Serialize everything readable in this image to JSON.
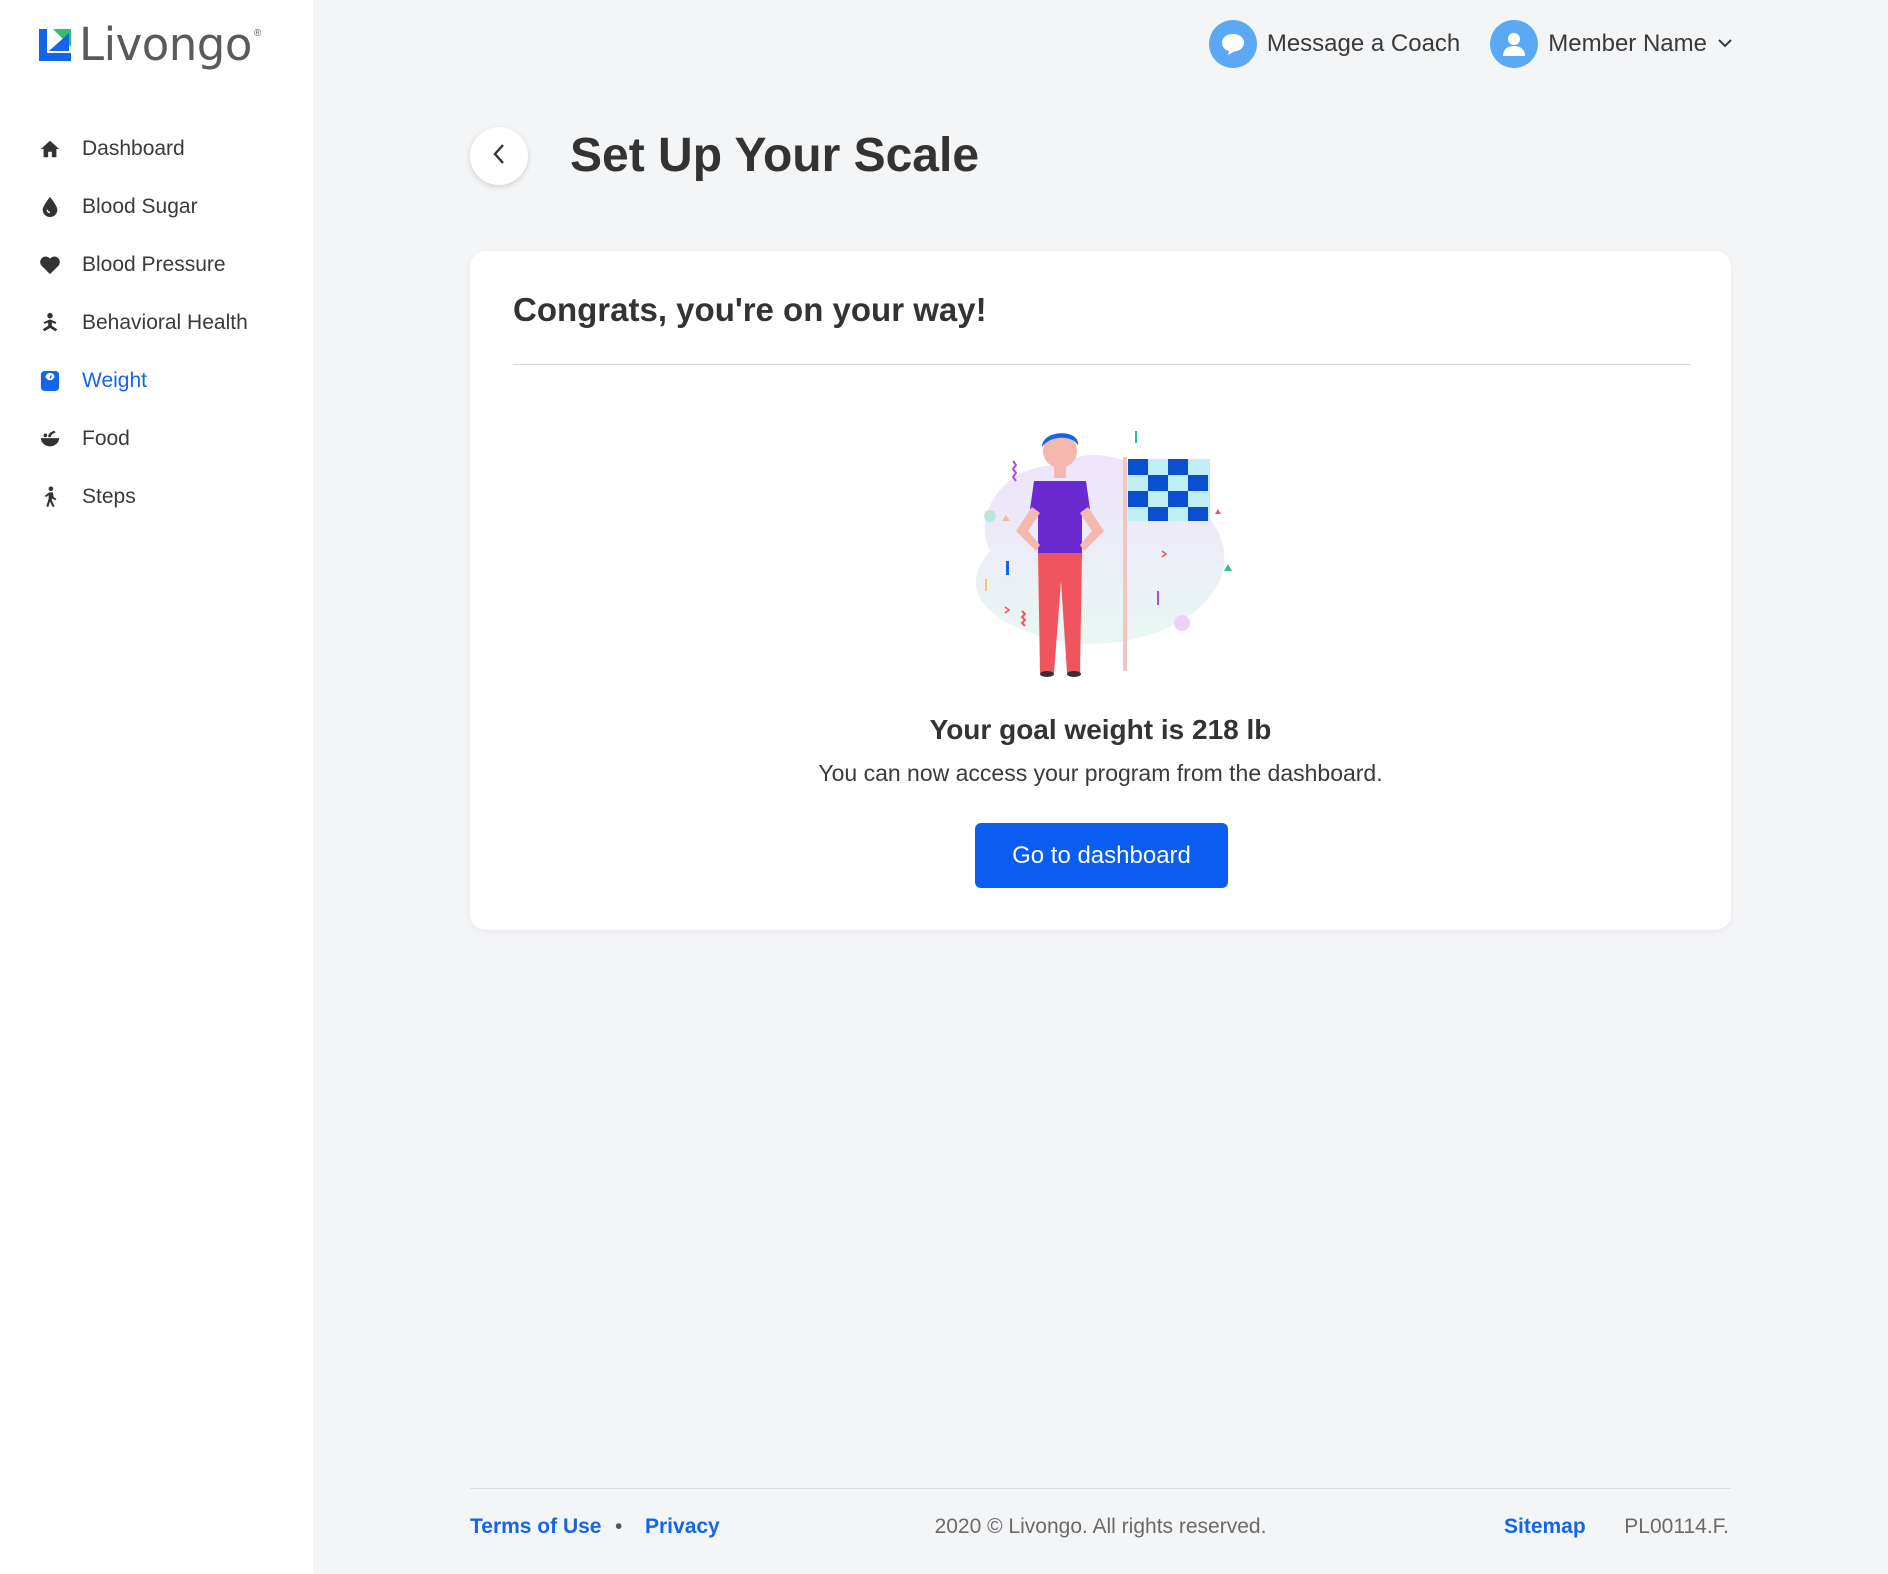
{
  "brand": {
    "name": "Livongo",
    "registered": "®",
    "colors": {
      "blue": "#1565e8",
      "green": "#2fbf71"
    }
  },
  "sidebar": {
    "items": [
      {
        "label": "Dashboard",
        "icon": "home-icon",
        "active": false
      },
      {
        "label": "Blood Sugar",
        "icon": "drop-icon",
        "active": false
      },
      {
        "label": "Blood Pressure",
        "icon": "heart-icon",
        "active": false
      },
      {
        "label": "Behavioral Health",
        "icon": "meditation-icon",
        "active": false
      },
      {
        "label": "Weight",
        "icon": "scale-icon",
        "active": true
      },
      {
        "label": "Food",
        "icon": "bowl-icon",
        "active": false
      },
      {
        "label": "Steps",
        "icon": "walking-icon",
        "active": false
      }
    ]
  },
  "topbar": {
    "message_coach": "Message a Coach",
    "member_name": "Member Name"
  },
  "header": {
    "title": "Set Up Your Scale"
  },
  "card": {
    "title": "Congrats, you're on your way!",
    "goal_text": "Your goal weight is 218 lb",
    "sub_text": "You can now access your program from the dashboard.",
    "cta_label": "Go to dashboard"
  },
  "footer": {
    "terms": "Terms of Use",
    "separator": "•",
    "privacy": "Privacy",
    "copyright": "2020 © Livongo. All rights reserved.",
    "sitemap": "Sitemap",
    "code": "PL00114.F."
  }
}
